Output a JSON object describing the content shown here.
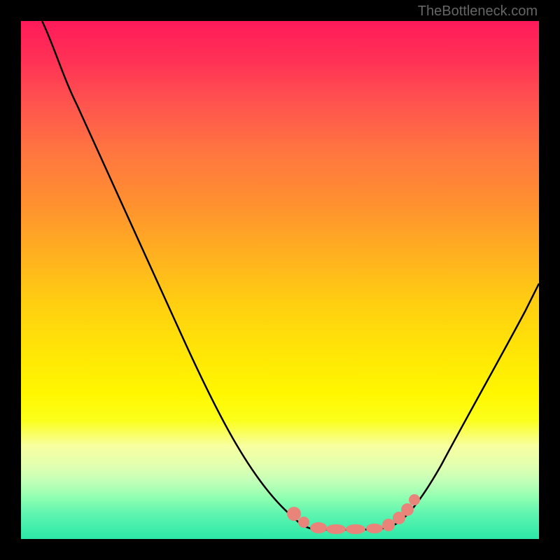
{
  "watermark": "TheBottleneck.com",
  "chart_data": {
    "type": "line",
    "title": "",
    "xlabel": "",
    "ylabel": "",
    "series": [
      {
        "name": "curve",
        "x": [
          0.04,
          0.08,
          0.12,
          0.16,
          0.2,
          0.24,
          0.28,
          0.32,
          0.36,
          0.4,
          0.44,
          0.48,
          0.52,
          0.56,
          0.6,
          0.64,
          0.68,
          0.72,
          0.76,
          0.8,
          0.84,
          0.88,
          0.92,
          0.96,
          1.0
        ],
        "y": [
          1.0,
          0.92,
          0.84,
          0.76,
          0.68,
          0.6,
          0.52,
          0.44,
          0.36,
          0.28,
          0.2,
          0.12,
          0.06,
          0.03,
          0.02,
          0.02,
          0.02,
          0.03,
          0.06,
          0.12,
          0.2,
          0.28,
          0.36,
          0.44,
          0.52
        ]
      },
      {
        "name": "points",
        "x": [
          0.52,
          0.55,
          0.58,
          0.61,
          0.64,
          0.67,
          0.7,
          0.73,
          0.75,
          0.77
        ],
        "y": [
          0.06,
          0.04,
          0.03,
          0.03,
          0.03,
          0.03,
          0.03,
          0.04,
          0.06,
          0.08
        ]
      }
    ],
    "xlim": [
      0,
      1
    ],
    "ylim": [
      0,
      1
    ],
    "colors": {
      "curve": "#000000",
      "points": "#e8847a",
      "background_gradient": [
        "#ff1a5a",
        "#ffe805",
        "#2ce8a8"
      ]
    }
  }
}
